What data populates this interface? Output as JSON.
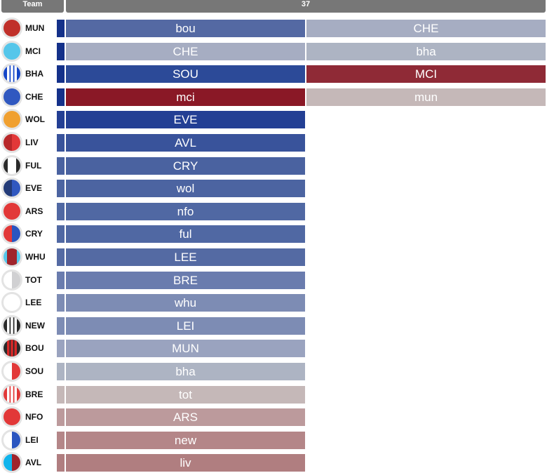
{
  "header": {
    "team_label": "Team",
    "gameweek_label": "37"
  },
  "colors": {
    "header_bg": "#777777",
    "strip_top": "#14318a"
  },
  "teams": [
    {
      "abbr": "MUN",
      "crest": "mun-crest-icon",
      "kit": "solid",
      "c1": "#c0302a",
      "c2": "#c0302a",
      "strip": "#14318a",
      "fixtures": [
        {
          "label": "bou",
          "color": "#5469a3"
        },
        {
          "label": "CHE",
          "color": "#a6adc2"
        }
      ]
    },
    {
      "abbr": "MCI",
      "crest": "mci-crest-icon",
      "kit": "solid",
      "c1": "#55c6ea",
      "c2": "#55c6ea",
      "strip": "#14318a",
      "fixtures": [
        {
          "label": "CHE",
          "color": "#a6adc2"
        },
        {
          "label": "bha",
          "color": "#adb4c3"
        }
      ]
    },
    {
      "abbr": "BHA",
      "crest": "bha-crest-icon",
      "kit": "stripes",
      "c1": "#1446c8",
      "c2": "#ffffff",
      "strip": "#14318a",
      "fixtures": [
        {
          "label": "SOU",
          "color": "#2c4a98"
        },
        {
          "label": "MCI",
          "color": "#8f2a36"
        }
      ]
    },
    {
      "abbr": "CHE",
      "crest": "che-crest-icon",
      "kit": "solid",
      "c1": "#3058c0",
      "c2": "#3058c0",
      "strip": "#14318a",
      "fixtures": [
        {
          "label": "mci",
          "color": "#8a1826"
        },
        {
          "label": "mun",
          "color": "#c5b8b8"
        }
      ]
    },
    {
      "abbr": "WOL",
      "crest": "wol-crest-icon",
      "kit": "solid",
      "c1": "#f0a030",
      "c2": "#f0a030",
      "strip": "#233f94",
      "fixtures": [
        {
          "label": "EVE",
          "color": "#233f94"
        }
      ]
    },
    {
      "abbr": "LIV",
      "crest": "liv-crest-icon",
      "kit": "halves",
      "c1": "#b8282a",
      "c2": "#e23838",
      "strip": "#39539b",
      "fixtures": [
        {
          "label": "AVL",
          "color": "#39539b"
        }
      ]
    },
    {
      "abbr": "FUL",
      "crest": "ful-crest-icon",
      "kit": "sides",
      "c1": "#2a2a2a",
      "c2": "#ffffff",
      "strip": "#4a62a0",
      "fixtures": [
        {
          "label": "CRY",
          "color": "#4a62a0"
        }
      ]
    },
    {
      "abbr": "EVE",
      "crest": "eve-crest-icon",
      "kit": "halves",
      "c1": "#233b78",
      "c2": "#3058c0",
      "strip": "#4c64a1",
      "fixtures": [
        {
          "label": "wol",
          "color": "#4c64a1"
        }
      ]
    },
    {
      "abbr": "ARS",
      "crest": "ars-crest-icon",
      "kit": "solid",
      "c1": "#e23838",
      "c2": "#e23838",
      "strip": "#5068a3",
      "fixtures": [
        {
          "label": "nfo",
          "color": "#5068a3"
        }
      ]
    },
    {
      "abbr": "CRY",
      "crest": "cry-crest-icon",
      "kit": "halves",
      "c1": "#e23838",
      "c2": "#2a55c0",
      "strip": "#5068a3",
      "fixtures": [
        {
          "label": "ful",
          "color": "#5068a3"
        }
      ]
    },
    {
      "abbr": "WHU",
      "crest": "whu-crest-icon",
      "kit": "center",
      "c1": "#55c6ea",
      "c2": "#a0242c",
      "strip": "#546aa3",
      "fixtures": [
        {
          "label": "LEE",
          "color": "#546aa3"
        }
      ]
    },
    {
      "abbr": "TOT",
      "crest": "tot-crest-icon",
      "kit": "halves",
      "c1": "#ffffff",
      "c2": "#d0d0d2",
      "strip": "#6a7cae",
      "fixtures": [
        {
          "label": "BRE",
          "color": "#6a7cae"
        }
      ]
    },
    {
      "abbr": "LEE",
      "crest": "lee-crest-icon",
      "kit": "solid",
      "c1": "#ffffff",
      "c2": "#ffffff",
      "strip": "#7d8cb4",
      "fixtures": [
        {
          "label": "whu",
          "color": "#7d8cb4"
        }
      ]
    },
    {
      "abbr": "NEW",
      "crest": "new-crest-icon",
      "kit": "stripes",
      "c1": "#2a2a2a",
      "c2": "#ffffff",
      "strip": "#7d8cb4",
      "fixtures": [
        {
          "label": "LEI",
          "color": "#7d8cb4"
        }
      ]
    },
    {
      "abbr": "BOU",
      "crest": "bou-crest-icon",
      "kit": "stripes",
      "c1": "#2a2a2a",
      "c2": "#d82828",
      "strip": "#9aa3bf",
      "fixtures": [
        {
          "label": "MUN",
          "color": "#9aa3bf"
        }
      ]
    },
    {
      "abbr": "SOU",
      "crest": "sou-crest-icon",
      "kit": "halves",
      "c1": "#ffffff",
      "c2": "#e23838",
      "strip": "#adb4c3",
      "fixtures": [
        {
          "label": "bha",
          "color": "#adb4c3"
        }
      ]
    },
    {
      "abbr": "BRE",
      "crest": "bre-crest-icon",
      "kit": "stripes",
      "c1": "#e23838",
      "c2": "#ffffff",
      "strip": "#c5b8b8",
      "fixtures": [
        {
          "label": "tot",
          "color": "#c5b8b8"
        }
      ]
    },
    {
      "abbr": "NFO",
      "crest": "nfo-crest-icon",
      "kit": "solid",
      "c1": "#e23838",
      "c2": "#e23838",
      "strip": "#bc9a9c",
      "fixtures": [
        {
          "label": "ARS",
          "color": "#bc9a9c"
        }
      ]
    },
    {
      "abbr": "LEI",
      "crest": "lei-crest-icon",
      "kit": "halves",
      "c1": "#ffffff",
      "c2": "#2a55c0",
      "strip": "#b48688",
      "fixtures": [
        {
          "label": "new",
          "color": "#b48688"
        }
      ]
    },
    {
      "abbr": "AVL",
      "crest": "avl-crest-icon",
      "kit": "halves",
      "c1": "#10b4ec",
      "c2": "#a0242c",
      "strip": "#b07e80",
      "fixtures": [
        {
          "label": "liv",
          "color": "#b07e80"
        }
      ]
    }
  ]
}
